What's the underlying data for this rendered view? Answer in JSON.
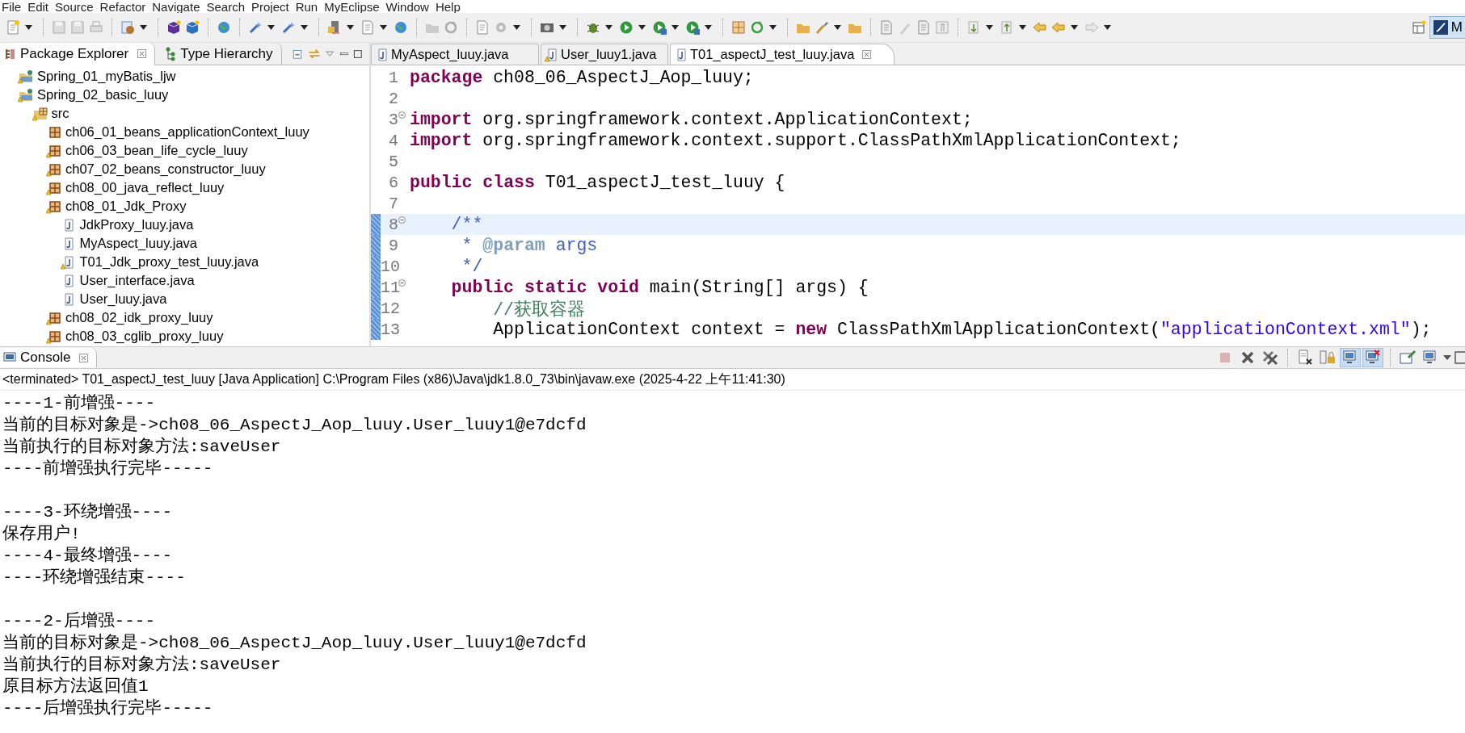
{
  "menu": [
    "File",
    "Edit",
    "Source",
    "Refactor",
    "Navigate",
    "Search",
    "Project",
    "Run",
    "MyEclipse",
    "Window",
    "Help"
  ],
  "perspective": {
    "label": "M",
    "selected": true
  },
  "explorer": {
    "tabs": [
      {
        "label": "Package Explorer",
        "selected": true
      },
      {
        "label": "Type Hierarchy",
        "selected": false
      }
    ],
    "tree": [
      {
        "label": "Spring_01_myBatis_ljw",
        "kind": "project",
        "warning": true
      },
      {
        "label": "Spring_02_basic_luuy",
        "kind": "project",
        "warning": true,
        "children": [
          {
            "label": "src",
            "kind": "source-folder",
            "warning": true,
            "children": [
              {
                "label": "ch06_01_beans_applicationContext_luuy",
                "kind": "package",
                "warning": false
              },
              {
                "label": "ch06_03_bean_life_cycle_luuy",
                "kind": "package",
                "warning": true
              },
              {
                "label": "ch07_02_beans_constructor_luuy",
                "kind": "package",
                "warning": true
              },
              {
                "label": "ch08_00_java_reflect_luuy",
                "kind": "package",
                "warning": true
              },
              {
                "label": "ch08_01_Jdk_Proxy",
                "kind": "package",
                "warning": true,
                "children": [
                  {
                    "label": "JdkProxy_luuy.java",
                    "kind": "java-file",
                    "warning": false
                  },
                  {
                    "label": "MyAspect_luuy.java",
                    "kind": "java-file",
                    "warning": false
                  },
                  {
                    "label": "T01_Jdk_proxy_test_luuy.java",
                    "kind": "java-file",
                    "warning": true
                  },
                  {
                    "label": "User_interface.java",
                    "kind": "java-file",
                    "warning": false
                  },
                  {
                    "label": "User_luuy.java",
                    "kind": "java-file",
                    "warning": false
                  }
                ]
              },
              {
                "label": "ch08_02_idk_proxy_luuy",
                "kind": "package",
                "warning": true
              },
              {
                "label": "ch08_03_cglib_proxy_luuy",
                "kind": "package",
                "warning": true
              }
            ]
          }
        ]
      }
    ]
  },
  "editor": {
    "tabs": [
      {
        "label": "MyAspect_luuy.java",
        "selected": false,
        "warning": false
      },
      {
        "label": "User_luuy1.java",
        "selected": false,
        "warning": true
      },
      {
        "label": "T01_aspectJ_test_luuy.java",
        "selected": true,
        "warning": false
      }
    ],
    "lines": [
      {
        "number": "1",
        "collapsible": false,
        "changed": false,
        "current": false,
        "tokens": [
          {
            "kind": "keyword",
            "text": "package "
          },
          {
            "kind": "plain",
            "text": "ch08_06_AspectJ_Aop_luuy;"
          }
        ]
      },
      {
        "number": "2",
        "collapsible": false,
        "changed": false,
        "current": false
      },
      {
        "number": "3",
        "collapsible": true,
        "changed": false,
        "current": false,
        "tokens": [
          {
            "kind": "keyword",
            "text": "import "
          },
          {
            "kind": "plain",
            "text": "org.springframework.context.ApplicationContext;"
          }
        ]
      },
      {
        "number": "4",
        "collapsible": false,
        "changed": false,
        "current": false,
        "tokens": [
          {
            "kind": "keyword",
            "text": "import "
          },
          {
            "kind": "plain",
            "text": "org.springframework.context.support.ClassPathXmlApplicationContext;"
          }
        ]
      },
      {
        "number": "5",
        "collapsible": false,
        "changed": false,
        "current": false
      },
      {
        "number": "6",
        "collapsible": false,
        "changed": false,
        "current": false,
        "tokens": [
          {
            "kind": "keyword",
            "text": "public "
          },
          {
            "kind": "keyword",
            "text": "class "
          },
          {
            "kind": "plain",
            "text": "T01_aspectJ_test_luuy {"
          }
        ]
      },
      {
        "number": "7",
        "collapsible": false,
        "changed": false,
        "current": false
      },
      {
        "number": "8",
        "collapsible": true,
        "changed": true,
        "current": true,
        "tokens": [
          {
            "kind": "javadoc",
            "text": "    /**"
          }
        ]
      },
      {
        "number": "9",
        "collapsible": false,
        "changed": true,
        "current": false,
        "tokens": [
          {
            "kind": "javadoc",
            "text": "     * "
          },
          {
            "kind": "javadoc-tag",
            "text": "@param"
          },
          {
            "kind": "javadoc",
            "text": " args"
          }
        ]
      },
      {
        "number": "10",
        "collapsible": false,
        "changed": true,
        "current": false,
        "tokens": [
          {
            "kind": "javadoc",
            "text": "     */"
          }
        ]
      },
      {
        "number": "11",
        "collapsible": true,
        "changed": true,
        "current": false,
        "tokens": [
          {
            "kind": "keyword",
            "text": "    public "
          },
          {
            "kind": "keyword",
            "text": "static "
          },
          {
            "kind": "keyword",
            "text": "void "
          },
          {
            "kind": "plain",
            "text": "main(String[] args) {"
          }
        ]
      },
      {
        "number": "12",
        "collapsible": false,
        "changed": true,
        "current": false,
        "tokens": [
          {
            "kind": "comment",
            "text": "        //获取容器"
          }
        ]
      },
      {
        "number": "13",
        "collapsible": false,
        "changed": true,
        "current": false,
        "tokens": [
          {
            "kind": "plain",
            "text": "        ApplicationContext context = "
          },
          {
            "kind": "keyword",
            "text": "new "
          },
          {
            "kind": "plain",
            "text": "ClassPathXmlApplicationContext("
          },
          {
            "kind": "string",
            "text": "\"applicationContext.xml\""
          },
          {
            "kind": "plain",
            "text": ");"
          }
        ]
      }
    ]
  },
  "console": {
    "title": "Console",
    "toolbar": [
      {
        "kind": "terminate",
        "disabled": true,
        "pressed": false
      },
      {
        "kind": "remove",
        "disabled": false,
        "pressed": false
      },
      {
        "kind": "remove-all",
        "disabled": false,
        "pressed": false
      },
      {
        "kind": "clear",
        "disabled": false,
        "pressed": false
      },
      {
        "kind": "lock",
        "disabled": false,
        "pressed": false
      },
      {
        "kind": "show-out",
        "disabled": false,
        "pressed": true
      },
      {
        "kind": "show-err",
        "disabled": false,
        "pressed": true
      },
      {
        "kind": "pin",
        "disabled": false,
        "pressed": false
      },
      {
        "kind": "display",
        "disabled": false,
        "pressed": false
      }
    ],
    "status": "<terminated> T01_aspectJ_test_luuy [Java Application] C:\\Program Files (x86)\\Java\\jdk1.8.0_73\\bin\\javaw.exe (2025-4-22 上午11:41:30)",
    "output": [
      {
        "kind": "text",
        "text": "----1-前增强----"
      },
      {
        "kind": "text",
        "text": "当前的目标对象是->ch08_06_AspectJ_Aop_luuy.User_luuy1@e7dcfd"
      },
      {
        "kind": "text",
        "text": "当前执行的目标对象方法:saveUser"
      },
      {
        "kind": "text",
        "text": "----前增强执行完毕-----"
      },
      {
        "kind": "blank"
      },
      {
        "kind": "text",
        "text": "----3-环绕增强----"
      },
      {
        "kind": "text",
        "text": "保存用户!"
      },
      {
        "kind": "text",
        "text": "----4-最终增强----"
      },
      {
        "kind": "text",
        "text": "----环绕增强结束----"
      },
      {
        "kind": "blank"
      },
      {
        "kind": "text",
        "text": "----2-后增强----"
      },
      {
        "kind": "text",
        "text": "当前的目标对象是->ch08_06_AspectJ_Aop_luuy.User_luuy1@e7dcfd"
      },
      {
        "kind": "text",
        "text": "当前执行的目标对象方法:saveUser"
      },
      {
        "kind": "text",
        "text": "原目标方法返回值1"
      },
      {
        "kind": "text",
        "text": "----后增强执行完毕-----"
      }
    ]
  }
}
